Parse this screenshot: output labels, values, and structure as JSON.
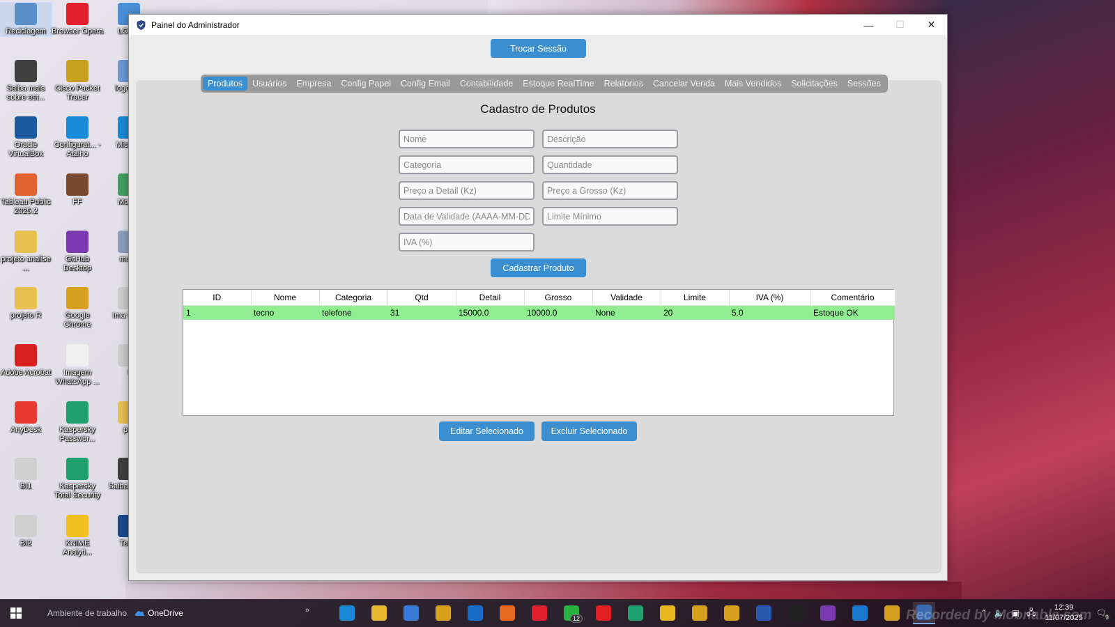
{
  "desktop": {
    "icons": [
      {
        "label": "Reciclagem",
        "icon": "recycle-bin-icon",
        "color": "#5a8fc8"
      },
      {
        "label": "Browser Opera",
        "icon": "opera-icon",
        "color": "#e0202c"
      },
      {
        "label": "LOGO",
        "icon": "file-icon",
        "color": "#4a90d9"
      },
      {
        "label": "Saiba mais sobre est...",
        "icon": "camera-icon",
        "color": "#404040"
      },
      {
        "label": "Cisco Packet Tracer",
        "icon": "cisco-icon",
        "color": "#c8a020"
      },
      {
        "label": "logo mu",
        "icon": "file-icon",
        "color": "#6a9ad8"
      },
      {
        "label": "Oracle VirtualBox",
        "icon": "virtualbox-icon",
        "color": "#1c5aa0"
      },
      {
        "label": "Configurat... - Atalho",
        "icon": "edge-icon",
        "color": "#1a8ad8"
      },
      {
        "label": "Micr Ed",
        "icon": "edge-icon",
        "color": "#1a8ad8"
      },
      {
        "label": "Tableau Public 2025.2",
        "icon": "tableau-icon",
        "color": "#e06030"
      },
      {
        "label": "FF",
        "icon": "photo-icon",
        "color": "#7a4a30"
      },
      {
        "label": "Mo Pa",
        "icon": "file-icon",
        "color": "#40a060"
      },
      {
        "label": "projeto analise ...",
        "icon": "folder-icon",
        "color": "#e8c050"
      },
      {
        "label": "GitHub Desktop",
        "icon": "github-icon",
        "color": "#7a3ab0"
      },
      {
        "label": "muak",
        "icon": "file-icon",
        "color": "#8aa0c0"
      },
      {
        "label": "projeto R",
        "icon": "folder-icon",
        "color": "#e8c050"
      },
      {
        "label": "Google Chrome",
        "icon": "chrome-icon",
        "color": "#d8a020"
      },
      {
        "label": "Ima What",
        "icon": "file-icon",
        "color": "#cccccc"
      },
      {
        "label": "Adobe Acrobat",
        "icon": "acrobat-icon",
        "color": "#d82020"
      },
      {
        "label": "Imagem WhatsApp ...",
        "icon": "file-icon",
        "color": "#f0f0f0"
      },
      {
        "label": "t",
        "icon": "file-icon",
        "color": "#cccccc"
      },
      {
        "label": "AnyDesk",
        "icon": "anydesk-icon",
        "color": "#e83a30"
      },
      {
        "label": "Kaspersky Passwor...",
        "icon": "kaspersky-icon",
        "color": "#20a070"
      },
      {
        "label": "pro",
        "icon": "folder-icon",
        "color": "#e8c050"
      },
      {
        "label": "BI1",
        "icon": "file-icon",
        "color": "#d0d0d0"
      },
      {
        "label": "Kaspersky Total Security",
        "icon": "kaspersky-icon",
        "color": "#20a070"
      },
      {
        "label": "Saiba sobre",
        "icon": "camera-icon",
        "color": "#404040"
      },
      {
        "label": "BI2",
        "icon": "file-icon",
        "color": "#d0d0d0"
      },
      {
        "label": "KNIME Analyti...",
        "icon": "knime-icon",
        "color": "#f0c020"
      },
      {
        "label": "Team",
        "icon": "teamviewer-icon",
        "color": "#1a4a90"
      }
    ]
  },
  "window": {
    "title": "Painel do Administrador",
    "minimize": "—",
    "maximize": "☐",
    "close": "✕"
  },
  "header": {
    "switch_session": "Trocar Sessão"
  },
  "tabs": [
    {
      "label": "Produtos",
      "active": true
    },
    {
      "label": "Usuários"
    },
    {
      "label": "Empresa"
    },
    {
      "label": "Config Papel"
    },
    {
      "label": "Config Email"
    },
    {
      "label": "Contabilidade"
    },
    {
      "label": "Estoque RealTime"
    },
    {
      "label": "Relatórios"
    },
    {
      "label": "Cancelar Venda"
    },
    {
      "label": "Mais Vendidos"
    },
    {
      "label": "Solicitações"
    },
    {
      "label": "Sessões"
    }
  ],
  "form": {
    "title": "Cadastro de Produtos",
    "placeholders": {
      "nome": "Nome",
      "descricao": "Descrição",
      "categoria": "Categoria",
      "quantidade": "Quantidade",
      "preco_detail": "Preço a Detail (Kz)",
      "preco_grosso": "Preço a Grosso (Kz)",
      "validade": "Data de Validade (AAAA-MM-DD)",
      "limite": "Limite Mínimo",
      "iva": "IVA (%)"
    },
    "submit": "Cadastrar Produto"
  },
  "table": {
    "columns": [
      "ID",
      "Nome",
      "Categoria",
      "Qtd",
      "Detail",
      "Grosso",
      "Validade",
      "Limite",
      "IVA (%)",
      "Comentário"
    ],
    "rows": [
      [
        "1",
        "tecno",
        "telefone",
        "31",
        "15000.0",
        "10000.0",
        "None",
        "20",
        "5.0",
        "Estoque OK"
      ]
    ],
    "row_color": "#90ee90"
  },
  "actions": {
    "edit": "Editar Selecionado",
    "delete": "Excluir Selecionado"
  },
  "taskbar": {
    "workspace": "Ambiente de trabalho",
    "onedrive": "OneDrive",
    "whatsapp_badge": "12",
    "time": "12:39",
    "date": "11/07/2025",
    "notification_count": "9",
    "watermark": "Recorded by Moonable.com"
  },
  "colors": {
    "accent": "#3b8ed0",
    "tab_bar": "#999999",
    "row_ok": "#90ee90"
  }
}
